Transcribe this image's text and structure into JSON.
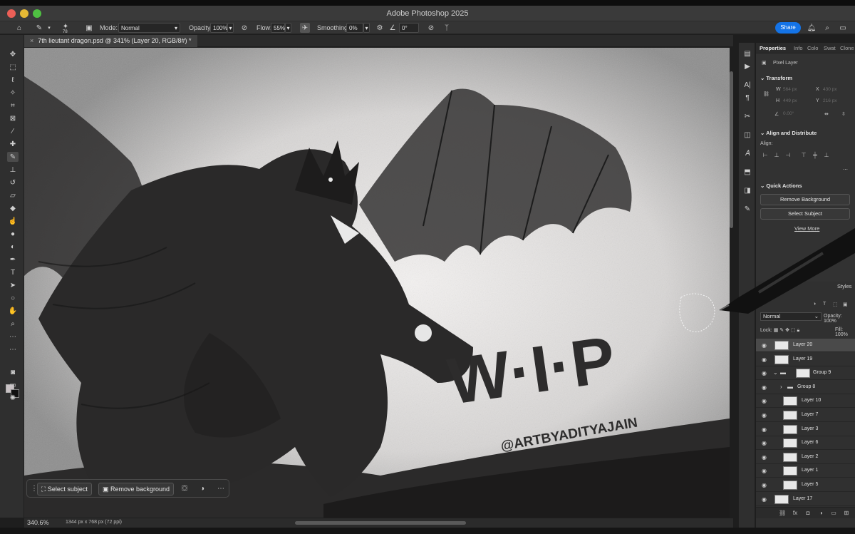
{
  "app": {
    "title": "Adobe Photoshop 2025"
  },
  "options_bar": {
    "brush_size": "78",
    "mode_label": "Mode:",
    "mode_value": "Normal",
    "opacity_label": "Opacity:",
    "opacity_value": "100%",
    "flow_label": "Flow:",
    "flow_value": "55%",
    "smoothing_label": "Smoothing:",
    "smoothing_value": "0%",
    "angle_value": "0°",
    "share_label": "Share"
  },
  "document": {
    "tab_title": "7th lieutant dragon.psd @ 341% (Layer 20, RGB/8#) *",
    "zoom_level": "340.6%",
    "doc_size": "1344 px x 768 px (72 ppi)"
  },
  "artwork": {
    "watermark_title": "W·I·P",
    "watermark_handle": "@ARTBYADITYAJAIN"
  },
  "task_bar": {
    "select_subject_label": "Select subject",
    "remove_background_label": "Remove background"
  },
  "properties_panel": {
    "tabs": [
      "Properties",
      "Info",
      "Colo",
      "Swat",
      "Clone"
    ],
    "pixel_layer_label": "Pixel Layer",
    "transform_title": "Transform",
    "w_label": "W",
    "w_value": "564 px",
    "h_label": "H",
    "h_value": "449 px",
    "x_label": "X",
    "x_value": "430 px",
    "y_label": "Y",
    "y_value": "216 px",
    "angle_value": "0.00°",
    "align_title": "Align and Distribute",
    "align_label": "Align:",
    "quick_actions_title": "Quick Actions",
    "remove_background_btn": "Remove Background",
    "select_subject_btn": "Select Subject",
    "view_more_link": "View More"
  },
  "layers_panel": {
    "styles_tab": "Styles",
    "blend_mode": "Normal",
    "opacity_label": "Opacity:",
    "opacity_value": "100%",
    "lock_label": "Lock:",
    "fill_label": "Fill:",
    "fill_value": "100%",
    "layers": [
      {
        "name": "Layer 20",
        "selected": true,
        "kind": "layer",
        "indent": 0
      },
      {
        "name": "Layer 19",
        "selected": false,
        "kind": "layer",
        "indent": 0
      },
      {
        "name": "Group 9",
        "selected": false,
        "kind": "group-open",
        "indent": 0
      },
      {
        "name": "Group 8",
        "selected": false,
        "kind": "group-closed",
        "indent": 1
      },
      {
        "name": "Layer 10",
        "selected": false,
        "kind": "layer",
        "indent": 1
      },
      {
        "name": "Layer 7",
        "selected": false,
        "kind": "layer",
        "indent": 1
      },
      {
        "name": "Layer 3",
        "selected": false,
        "kind": "layer",
        "indent": 1
      },
      {
        "name": "Layer 6",
        "selected": false,
        "kind": "layer",
        "indent": 1
      },
      {
        "name": "Layer 2",
        "selected": false,
        "kind": "layer",
        "indent": 1
      },
      {
        "name": "Layer 1",
        "selected": false,
        "kind": "layer",
        "indent": 1
      },
      {
        "name": "Layer 5",
        "selected": false,
        "kind": "layer",
        "indent": 1
      },
      {
        "name": "Layer 17",
        "selected": false,
        "kind": "layer",
        "indent": 0
      }
    ]
  },
  "colors": {
    "share_button": "#1473e6",
    "foreground": "#c9c1c4",
    "background": "#111111"
  }
}
